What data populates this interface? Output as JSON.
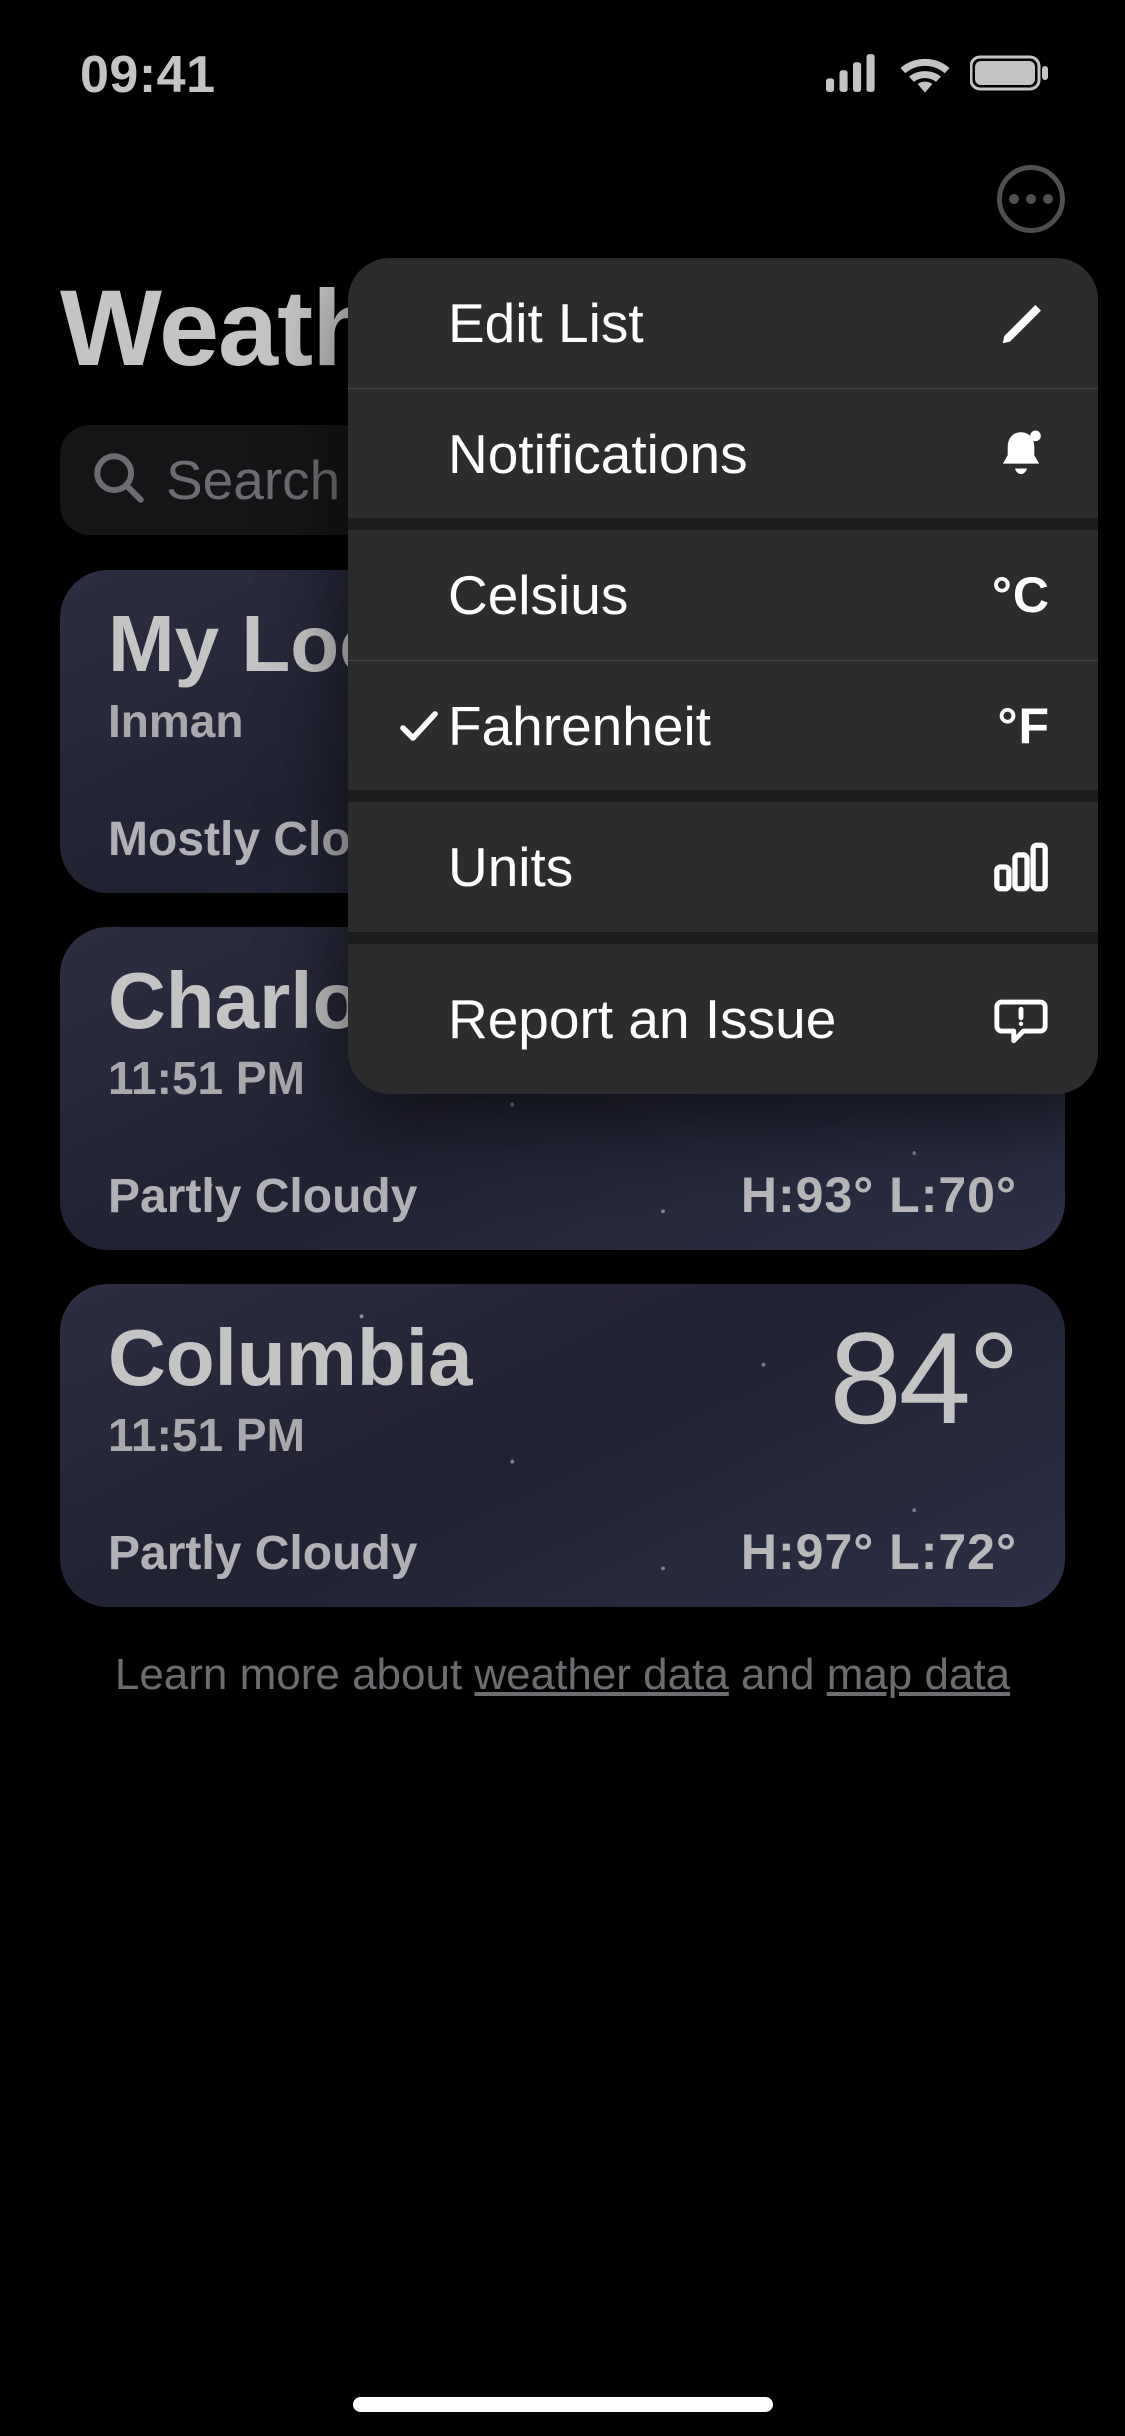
{
  "statusBar": {
    "time": "09:41"
  },
  "header": {
    "title": "Weather"
  },
  "search": {
    "placeholder": "Search for a city or airport"
  },
  "cards": [
    {
      "title": "My Location",
      "subtitle": "Inman",
      "temp": "",
      "condition": "Mostly Cloudy",
      "hiLo": ""
    },
    {
      "title": "Charlotte",
      "subtitle": "11:51 PM",
      "temp": "",
      "condition": "Partly Cloudy",
      "hiLo": "H:93°  L:70°"
    },
    {
      "title": "Columbia",
      "subtitle": "11:51 PM",
      "temp": "84°",
      "condition": "Partly Cloudy",
      "hiLo": "H:97°  L:72°"
    }
  ],
  "footer": {
    "prefix": "Learn more about ",
    "weatherLink": "weather data",
    "mid": " and ",
    "mapLink": "map data"
  },
  "menu": {
    "editList": "Edit List",
    "notifications": "Notifications",
    "celsius": "Celsius",
    "celsiusSymbol": "°C",
    "fahrenheit": "Fahrenheit",
    "fahrenheitSymbol": "°F",
    "units": "Units",
    "report": "Report an Issue"
  }
}
